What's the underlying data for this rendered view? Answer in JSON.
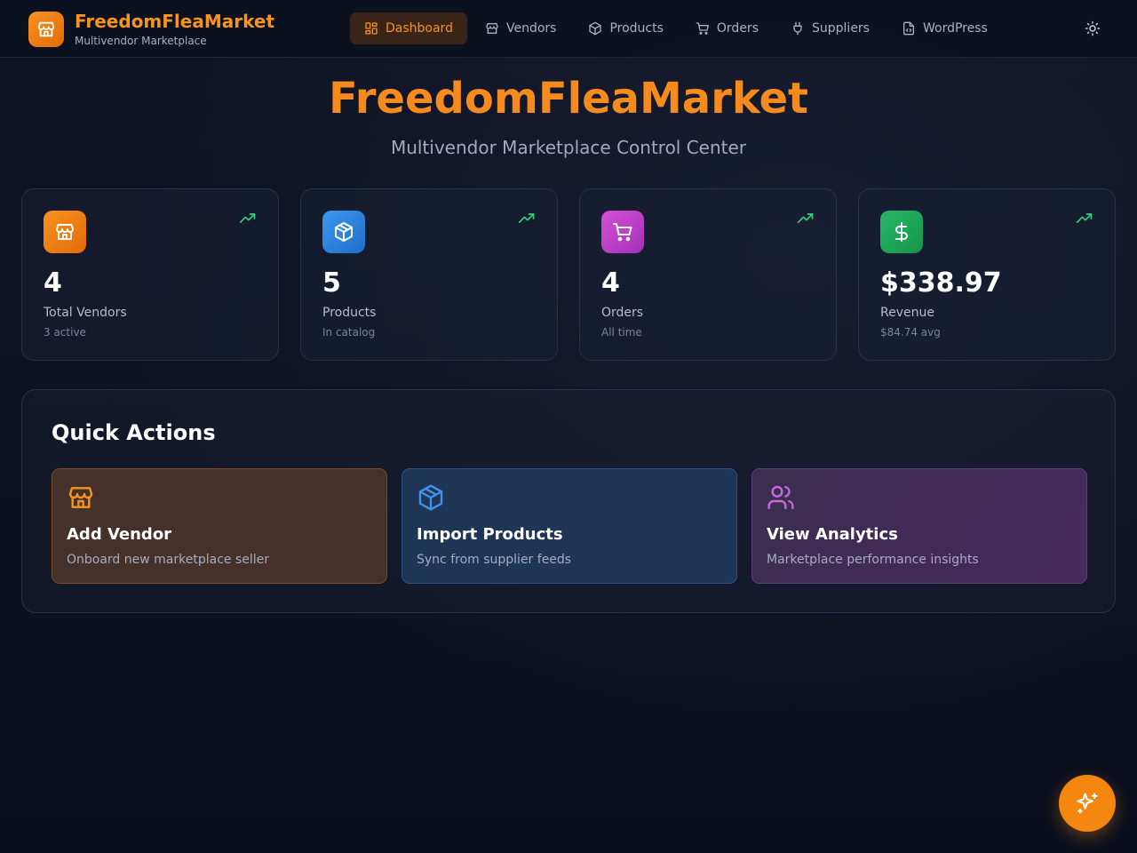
{
  "header": {
    "brand_name": "FreedomFleaMarket",
    "brand_subtitle": "Multivendor Marketplace",
    "nav": [
      {
        "label": "Dashboard",
        "icon": "dashboard-grid-icon",
        "active": true
      },
      {
        "label": "Vendors",
        "icon": "store-icon",
        "active": false
      },
      {
        "label": "Products",
        "icon": "package-icon",
        "active": false
      },
      {
        "label": "Orders",
        "icon": "cart-icon",
        "active": false
      },
      {
        "label": "Suppliers",
        "icon": "plug-icon",
        "active": false
      },
      {
        "label": "WordPress",
        "icon": "file-code-icon",
        "active": false
      }
    ],
    "theme_toggle_icon": "sun-icon"
  },
  "hero": {
    "title": "FreedomFleaMarket",
    "subtitle": "Multivendor Marketplace Control Center"
  },
  "stats": [
    {
      "value": "4",
      "label": "Total Vendors",
      "note": "3 active",
      "icon": "store-icon",
      "color": "#f17c0e"
    },
    {
      "value": "5",
      "label": "Products",
      "note": "In catalog",
      "icon": "package-icon",
      "color": "#2f86e0"
    },
    {
      "value": "4",
      "label": "Orders",
      "note": "All time",
      "icon": "cart-icon",
      "color": "#c13fc9"
    },
    {
      "value": "$338.97",
      "label": "Revenue",
      "note": "$84.74 avg",
      "icon": "dollar-icon",
      "color": "#1fa85a"
    }
  ],
  "quick_actions": {
    "title": "Quick Actions",
    "items": [
      {
        "name": "Add Vendor",
        "desc": "Onboard new marketplace seller",
        "icon": "store-icon"
      },
      {
        "name": "Import Products",
        "desc": "Sync from supplier feeds",
        "icon": "package-icon"
      },
      {
        "name": "View Analytics",
        "desc": "Marketplace performance insights",
        "icon": "users-icon"
      }
    ]
  },
  "fab": {
    "icon": "sparkles-icon"
  },
  "colors": {
    "accent": "#f7931e",
    "trend": "#34d27b",
    "background": "#0d1120"
  }
}
